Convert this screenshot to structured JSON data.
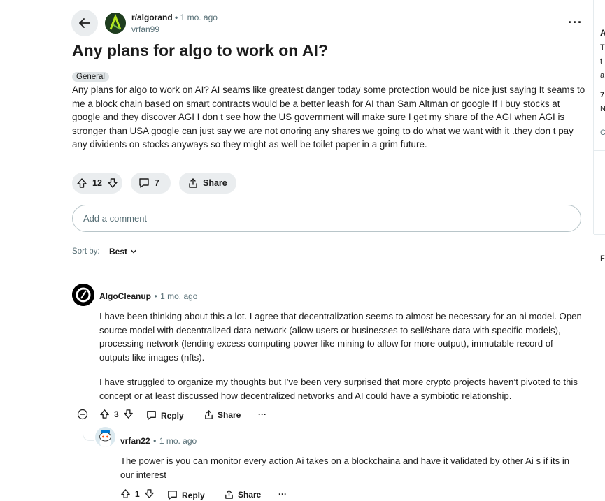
{
  "post": {
    "subreddit": "r/algorand",
    "separator": "•",
    "time": "1 mo. ago",
    "author": "vrfan99",
    "title": "Any plans for algo to work on AI?",
    "flair": "General",
    "body": "Any plans for algo to work on AI? AI seams like greatest danger today some protection would be nice just saying It seams to me a block chain based on smart contracts would be a better leash for AI than Sam Altman or google If I buy stocks at google and they discover AGI I don t see how the US government will make sure I get my share of the AGI when AGI is stronger than USA google can just say we are not onoring any shares we going to do what we want with it .they don t pay any dividents on stocks anyways so they might as well be toilet paper in a grim future.",
    "votes": "12",
    "comments": "7",
    "share_label": "Share"
  },
  "comment_input": {
    "placeholder": "Add a comment"
  },
  "sort": {
    "label": "Sort by:",
    "value": "Best"
  },
  "comments": [
    {
      "author": "AlgoCleanup",
      "separator": "•",
      "time": "1 mo. ago",
      "paragraphs": [
        "I have been thinking about this a lot. I agree that decentralization seems to almost be necessary for an ai model. Open source model with decentralized data network (allow users or businesses to sell/share data with specific models), processing network (lending excess computing power like mining to allow for more output), immutable record of outputs like images (nfts).",
        "I have struggled to organize my thoughts but I’ve been very surprised that more crypto projects haven’t pivoted to this concept or at least discussed how decentralized networks and AI could have a symbiotic relationship."
      ],
      "votes": "3",
      "reply_label": "Reply",
      "share_label": "Share",
      "more_label": "···"
    },
    {
      "author": "vrfan22",
      "separator": "•",
      "time": "1 mo. ago",
      "paragraphs": [
        "The power is you can monitor every action Ai takes on a blockchaina and have it validated by other Ai s if its in our interest"
      ],
      "votes": "1",
      "reply_label": "Reply",
      "share_label": "Share",
      "more_label": "···"
    }
  ],
  "more_label": "···",
  "sidebar_fragments": [
    "A",
    "T",
    "t",
    "a",
    "7",
    "N",
    "C",
    "F"
  ],
  "colors": {
    "pill_bg": "#eaedef",
    "muted": "#576f76",
    "text": "#1c1c1c",
    "border": "#b8c5c9"
  }
}
